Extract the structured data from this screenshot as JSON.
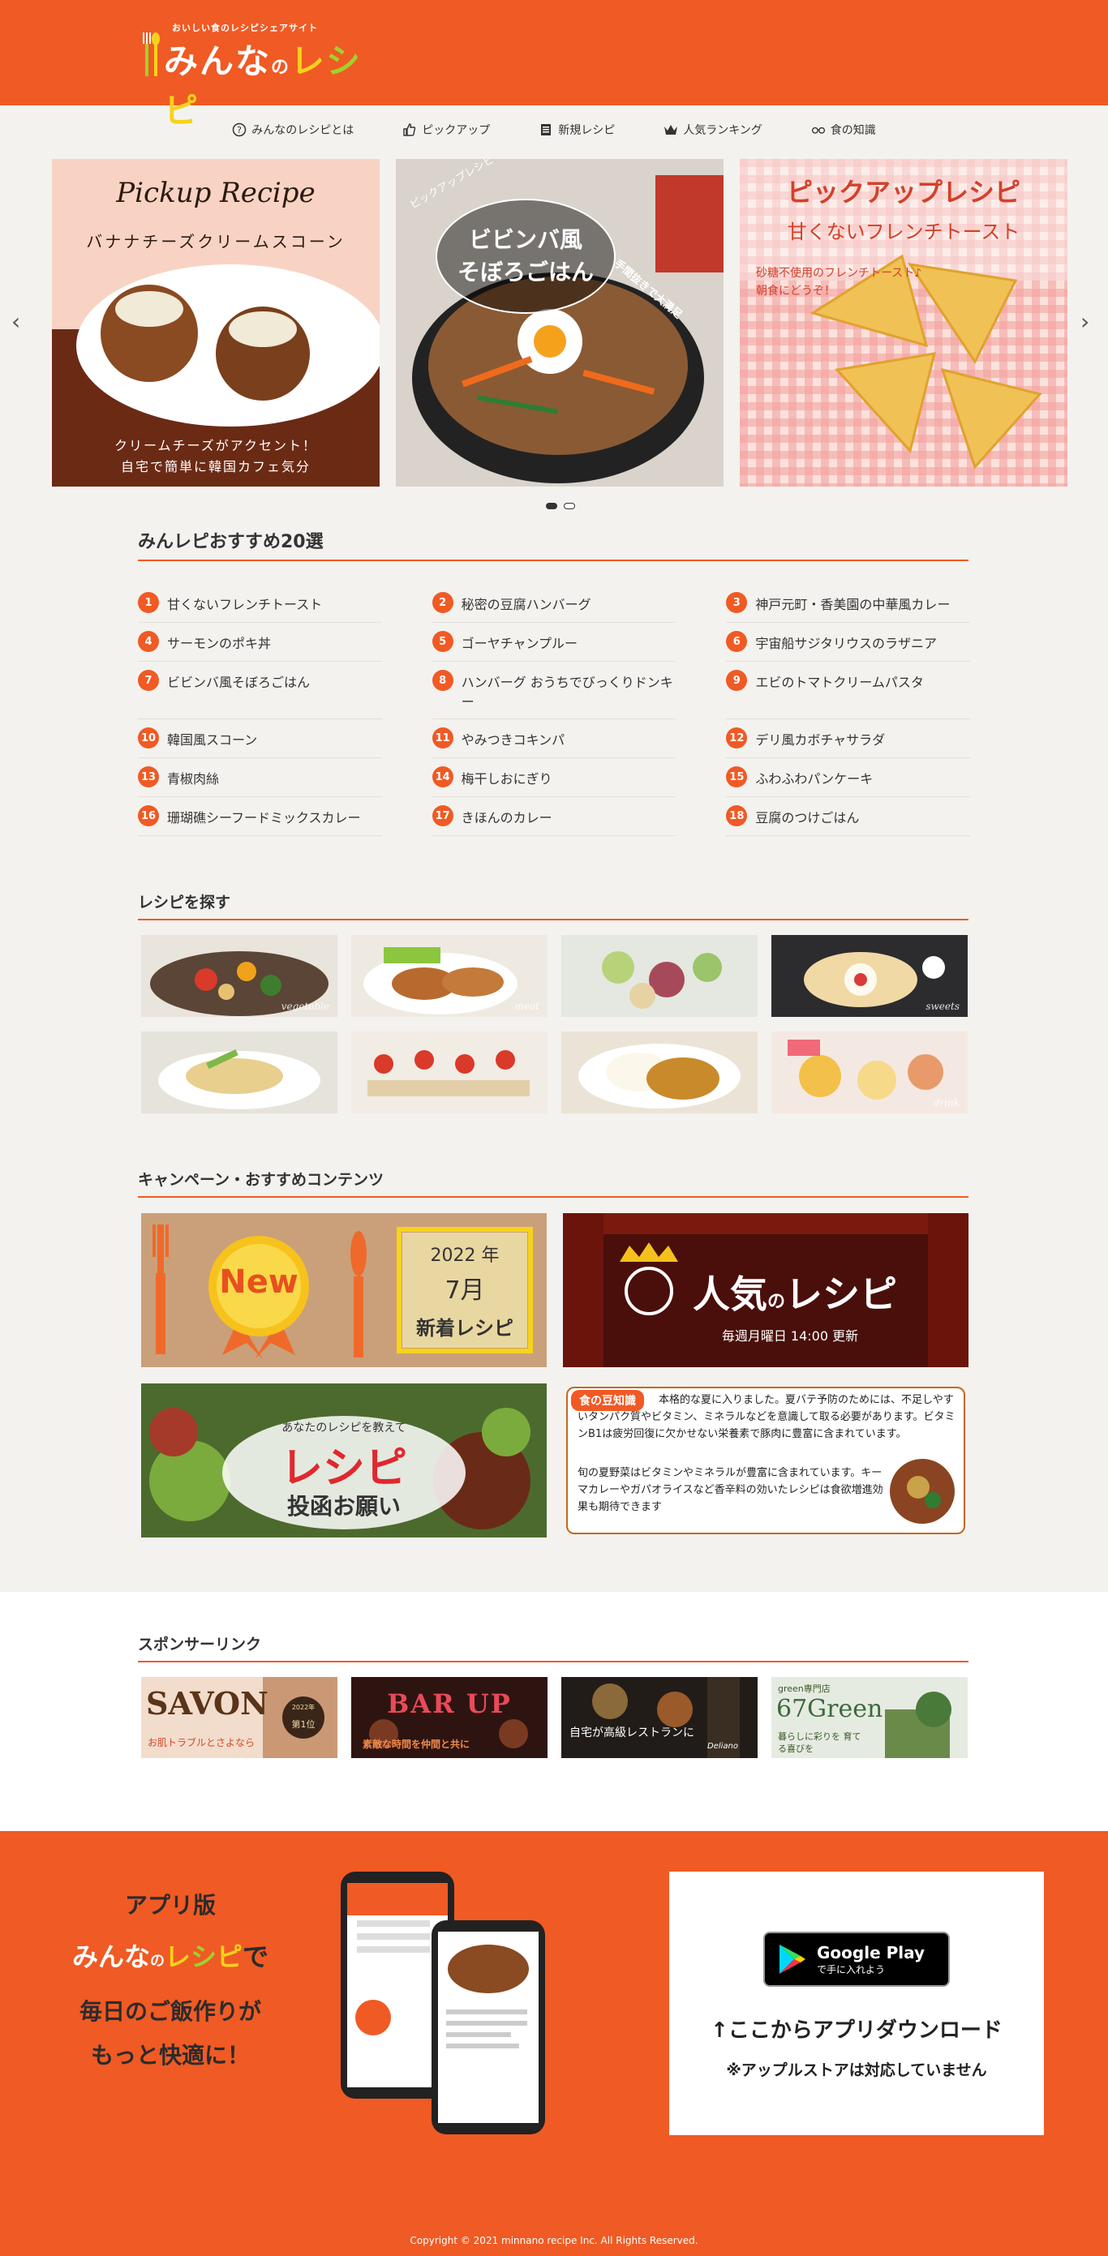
{
  "header": {
    "tagline": "おいしい食のレシピシェアサイト",
    "logo_parts": [
      "みんな",
      "の",
      "レ",
      "シ",
      "ピ"
    ]
  },
  "nav": [
    {
      "label": "みんなのレシピとは",
      "icon": "question-circle-icon"
    },
    {
      "label": "ピックアップ",
      "icon": "thumbs-up-icon"
    },
    {
      "label": "新規レシピ",
      "icon": "document-icon"
    },
    {
      "label": "人気ランキング",
      "icon": "crown-icon"
    },
    {
      "label": "食の知識",
      "icon": "glasses-icon"
    }
  ],
  "carousel": {
    "slides": [
      {
        "title": "Pickup Recipe",
        "subtitle": "バナナチーズクリームスコーン",
        "caption1": "クリームチーズがアクセント！",
        "caption2": "自宅で簡単に韓国カフェ気分"
      },
      {
        "badge": "ピックアップレシピ",
        "title1": "ビビンバ風",
        "title2": "そぼろごはん",
        "side": "手間抜きで大満足"
      },
      {
        "title": "ピックアップレシピ",
        "subtitle": "甘くないフレンチトースト",
        "caption1": "砂糖不使用のフレンチトースト♪",
        "caption2": "朝食にどうぞ！"
      }
    ]
  },
  "recommend": {
    "title": "みんレピおすすめ20選",
    "items": [
      {
        "n": "1",
        "label": "甘くないフレンチトースト"
      },
      {
        "n": "2",
        "label": "秘密の豆腐ハンバーグ"
      },
      {
        "n": "3",
        "label": "神戸元町・香美園の中華風カレー"
      },
      {
        "n": "4",
        "label": "サーモンのポキ丼"
      },
      {
        "n": "5",
        "label": "ゴーヤチャンプルー"
      },
      {
        "n": "6",
        "label": "宇宙船サジタリウスのラザニア"
      },
      {
        "n": "7",
        "label": "ビビンバ風そぼろごはん"
      },
      {
        "n": "8",
        "label": "ハンバーグ おうちでびっくりドンキー"
      },
      {
        "n": "9",
        "label": "エビのトマトクリームパスタ"
      },
      {
        "n": "10",
        "label": "韓国風スコーン"
      },
      {
        "n": "11",
        "label": "やみつきコキンパ"
      },
      {
        "n": "12",
        "label": "デリ風カボチャサラダ"
      },
      {
        "n": "13",
        "label": "青椒肉絲"
      },
      {
        "n": "14",
        "label": "梅干しおにぎり"
      },
      {
        "n": "15",
        "label": "ふわふわパンケーキ"
      },
      {
        "n": "16",
        "label": "珊瑚礁シーフードミックスカレー"
      },
      {
        "n": "17",
        "label": "きほんのカレー"
      },
      {
        "n": "18",
        "label": "豆腐のつけごはん"
      }
    ]
  },
  "search": {
    "title": "レシピを探す",
    "tiles": [
      "vegetable",
      "meat",
      "",
      "sweets",
      "",
      "",
      "",
      "drink"
    ]
  },
  "campaign": {
    "title": "キャンペーン・おすすめコンテンツ",
    "new_badge": "New",
    "year": "2022 年",
    "month": "7月",
    "new_label": "新着レシピ",
    "popular_title": "人気",
    "popular_no": "の",
    "popular_recipe": "レシピ",
    "popular_sub": "毎週月曜日 14:00 更新",
    "submit_small": "あなたのレシピを教えて",
    "submit_big": "レシピ",
    "submit_label": "投函お願い",
    "knowledge_badge": "食の豆知識",
    "knowledge_text": "本格的な夏に入りました。夏バテ予防のためには、不足しやすいタンパク質やビタミン、ミネラルなどを意識して取る必要があります。ビタミンB1は疲労回復に欠かせない栄養素で豚肉に豊富に含まれています。",
    "knowledge_text2": "旬の夏野菜はビタミンやミネラルが豊富に含まれています。キーマカレーやガパオライスなど香辛料の効いたレシピは食欲増進効果も期待できます"
  },
  "sponsor": {
    "title": "スポンサーリンク",
    "items": [
      {
        "name": "SAVON",
        "sub": "お肌トラブルとさよなら",
        "badge_year": "2022年",
        "badge_rank": "第1位"
      },
      {
        "name": "BAR UP",
        "sub": "素敵な時間を仲間と共に"
      },
      {
        "name": "自宅が高級レストランに",
        "sub": "Deliano"
      },
      {
        "name": "67Green",
        "top": "green専門店",
        "sub": "暮らしに彩りを 育てる喜びを"
      }
    ]
  },
  "footer": {
    "app_label": "アプリ版",
    "app_suffix": "で",
    "app_line1": "毎日のご飯作りが",
    "app_line2": "もっと快適に！",
    "gp_small": "Google Play",
    "gp_sub": "で手に入れよう",
    "download": "↑ここからアプリダウンロード",
    "note": "※アップルストアは対応していません",
    "copyright": "Copyright © 2021 minnano recipe Inc. All Rights Reserved."
  },
  "colors": {
    "brand": "#f05a24",
    "bg": "#f3f2ef"
  }
}
